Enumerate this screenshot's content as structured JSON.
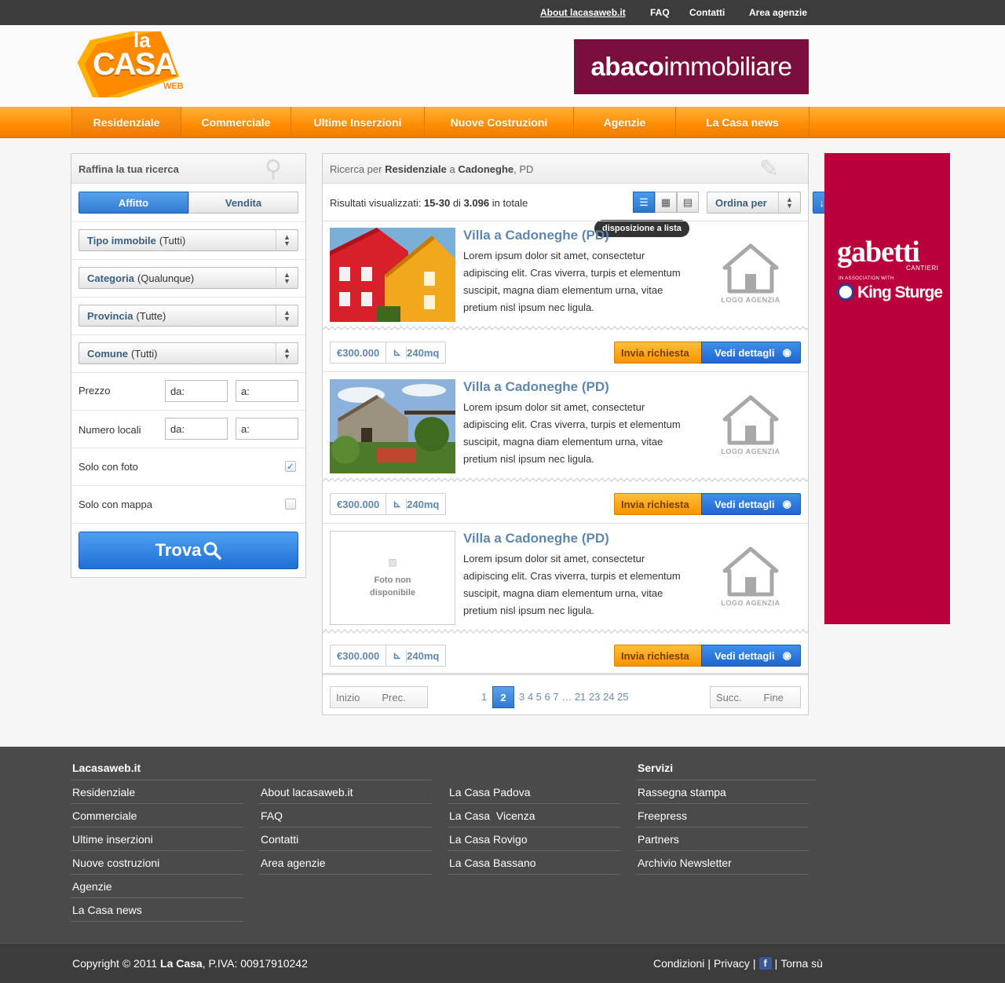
{
  "topbar": {
    "links": [
      "About lacasaweb.it",
      "FAQ",
      "Contatti",
      "Area agenzie"
    ]
  },
  "logo": {
    "la": "la",
    "casa": "CASA",
    "web": "WEB"
  },
  "banner_top": {
    "part1": "abaco",
    "part2": "immobiliare"
  },
  "nav": {
    "items": [
      "Residenziale",
      "Commerciale",
      "Ultime Inserzioni",
      "Nuove Costruzioni",
      "Agenzie",
      "La Casa news"
    ],
    "active": "Residenziale"
  },
  "sidebar": {
    "title": "Raffina la tua ricerca",
    "toggle": {
      "affitto": "Affitto",
      "vendita": "Vendita"
    },
    "selects": [
      {
        "label": "Tipo immobile",
        "value": "(Tutti)"
      },
      {
        "label": "Categoria",
        "value": "(Qualunque)"
      },
      {
        "label": "Provincia",
        "value": "(Tutte)"
      },
      {
        "label": "Comune",
        "value": "(Tutti)"
      }
    ],
    "prezzo": {
      "label": "Prezzo",
      "from_placeholder": "da:",
      "to_placeholder": "a:"
    },
    "locali": {
      "label": "Numero locali",
      "from_placeholder": "da:",
      "to_placeholder": "a:"
    },
    "solo_foto": {
      "label": "Solo con foto",
      "checked": true
    },
    "solo_mappa": {
      "label": "Solo con mappa",
      "checked": false
    },
    "button": "Trova"
  },
  "results": {
    "title_prefix": "Ricerca per",
    "title_category": "Residenziale",
    "title_mid": "a",
    "title_city": "Cadoneghe",
    "title_prov": ", PD",
    "count_prefix": "Risultati visualizzati:",
    "count_range": "15-30",
    "count_mid": "di",
    "count_total": "3.096",
    "count_suffix": "in totale",
    "tooltip": "disposizione a lista",
    "sort_label": "Ordina per",
    "listings": [
      {
        "title": "Villa a Cadoneghe (PD)",
        "desc": "Lorem ipsum dolor sit amet, consectetur adipiscing elit. Cras viverra, turpis et elementum suscipit, magna diam elementum urna, vitae pretium nisl ipsum nec ligula.",
        "price": "€300.000",
        "size": "240mq",
        "photo": "red-yellow-houses",
        "logo_text": "LOGO AGENZIA"
      },
      {
        "title": "Villa a Cadoneghe (PD)",
        "desc": "Lorem ipsum dolor sit amet, consectetur adipiscing elit. Cras viverra, turpis et elementum suscipit, magna diam elementum urna, vitae pretium nisl ipsum nec ligula.",
        "price": "€300.000",
        "size": "240mq",
        "photo": "stone-house-garden",
        "logo_text": "LOGO AGENZIA"
      },
      {
        "title": "Villa a Cadoneghe (PD)",
        "desc": "Lorem ipsum dolor sit amet, consectetur adipiscing elit. Cras viverra, turpis et elementum suscipit, magna diam elementum urna, vitae pretium nisl ipsum nec ligula.",
        "price": "€300.000",
        "size": "240mq",
        "photo": "none",
        "no_photo_text": "Foto non disponibile",
        "logo_text": "LOGO AGENZIA"
      }
    ],
    "actions": {
      "invia": "Invia richiesta",
      "vedi": "Vedi dettagli"
    },
    "pagination": {
      "inizio": "Inizio",
      "prec": "Prec.",
      "succ": "Succ.",
      "fine": "Fine",
      "pages_before": "1",
      "current": "2",
      "pages_after": "3 4 5 6 7 … 21 23 24 25"
    }
  },
  "ad": {
    "brand": "gabetti",
    "sub": "CANTIERI",
    "assoc": "IN ASSOCIATION WITH",
    "partner": "King Sturge"
  },
  "footer": {
    "col1_title": "Lacasaweb.it",
    "col1": [
      "Residenziale",
      "Commerciale",
      "Ultime inserzioni",
      "Nuove costruzioni",
      "Agenzie",
      "La Casa news"
    ],
    "col2": [
      "About lacasaweb.it",
      "FAQ",
      "Contatti",
      "Area agenzie"
    ],
    "col3": [
      "La Casa Padova",
      "La Casa  Vicenza",
      "La Casa Rovigo",
      "La Casa Bassano"
    ],
    "col4_title": "Servizi",
    "col4": [
      "Rassegna stampa",
      "Freepress",
      "Partners",
      "Archivio Newsletter"
    ]
  },
  "bottombar": {
    "copyright": "Copyright © 2011",
    "company": "La Casa",
    "piva": ", P.IVA: 00917910242",
    "condizioni": "Condizioni",
    "privacy": "Privacy",
    "torna": "Torna sù"
  }
}
